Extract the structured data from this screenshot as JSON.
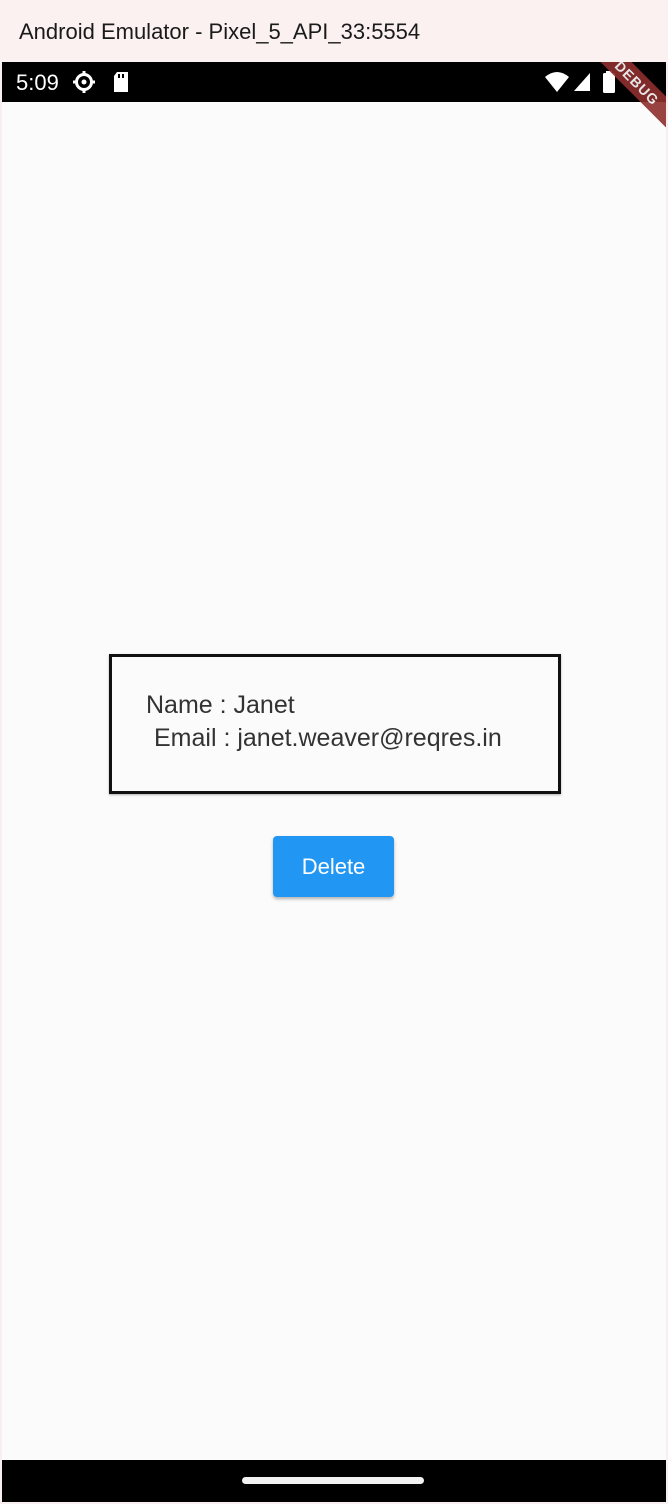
{
  "window": {
    "title": "Android Emulator - Pixel_5_API_33:5554"
  },
  "status_bar": {
    "time": "5:09",
    "icons": [
      "settings-gear-icon",
      "sd-card-icon",
      "wifi-icon",
      "signal-icon",
      "battery-icon"
    ],
    "debug_banner": "DEBUG"
  },
  "user_card": {
    "name_line": "Name : Janet",
    "email_line": "Email : janet.weaver@reqres.in"
  },
  "actions": {
    "delete_label": "Delete"
  },
  "colors": {
    "primary_button": "#2296f3",
    "debug_banner": "#8e2f2f",
    "background": "#fbfbfb"
  }
}
